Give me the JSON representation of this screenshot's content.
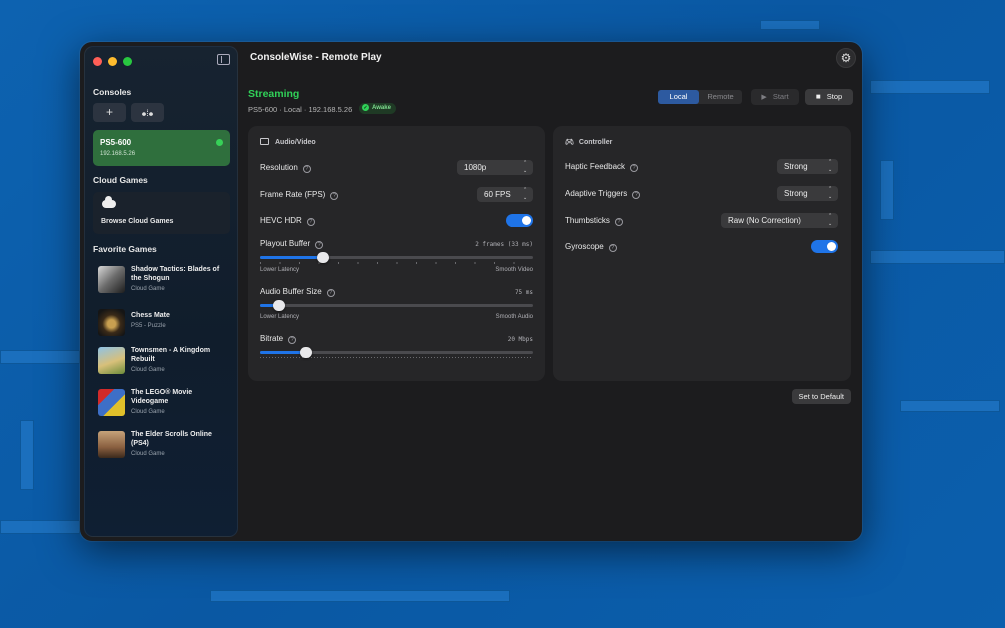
{
  "window": {
    "title": "ConsoleWise - Remote Play"
  },
  "sidebar": {
    "consoles_heading": "Consoles",
    "add_button_label": "+",
    "console": {
      "name": "PS5-600",
      "ip": "192.168.5.26",
      "status_color": "#37d158"
    },
    "cloud_heading": "Cloud Games",
    "browse_cloud_label": "Browse Cloud Games",
    "favorites_heading": "Favorite Games",
    "games": [
      {
        "title": "Shadow Tactics: Blades of the Shogun",
        "subtitle": "Cloud Game"
      },
      {
        "title": "Chess Mate",
        "subtitle": "PS5 - Puzzle"
      },
      {
        "title": "Townsmen - A Kingdom Rebuilt",
        "subtitle": "Cloud Game"
      },
      {
        "title": "The LEGO® Movie Videogame",
        "subtitle": "Cloud Game"
      },
      {
        "title": "The Elder Scrolls Online (PS4)",
        "subtitle": "Cloud Game"
      }
    ]
  },
  "status": {
    "title": "Streaming",
    "subtitle": "PS5-600 · Local · 192.168.5.26",
    "badge": "Awake"
  },
  "toolbar": {
    "segment_local": "Local",
    "segment_remote": "Remote",
    "selected_segment": "Local",
    "start_label": "Start",
    "stop_label": "Stop"
  },
  "audio_video": {
    "heading": "Audio/Video",
    "resolution_label": "Resolution",
    "resolution_value": "1080p",
    "frame_rate_label": "Frame Rate (FPS)",
    "frame_rate_value": "60 FPS",
    "hdr_label": "HEVC HDR",
    "hdr_enabled": true,
    "playout_label": "Playout Buffer",
    "playout_value": "2 frames (33 ms)",
    "playout_min_hint": "Lower Latency",
    "playout_max_hint": "Smooth Video",
    "playout_level": 0.23,
    "audio_buffer_label": "Audio Buffer Size",
    "audio_buffer_value": "75 ms",
    "audio_min_hint": "Lower Latency",
    "audio_max_hint": "Smooth Audio",
    "audio_level": 0.07,
    "bitrate_label": "Bitrate",
    "bitrate_value": "20 Mbps",
    "bitrate_level": 0.17
  },
  "controller": {
    "heading": "Controller",
    "haptic_label": "Haptic Feedback",
    "haptic_value": "Strong",
    "adaptive_label": "Adaptive Triggers",
    "adaptive_value": "Strong",
    "thumbsticks_label": "Thumbsticks",
    "thumbsticks_value": "Raw (No Correction)",
    "gyroscope_label": "Gyroscope",
    "gyroscope_enabled": true
  },
  "footer": {
    "set_default_label": "Set to Default"
  },
  "colors": {
    "accent": "#1f74e8",
    "streaming": "#30d158",
    "console_card": "#2f6f3d"
  }
}
